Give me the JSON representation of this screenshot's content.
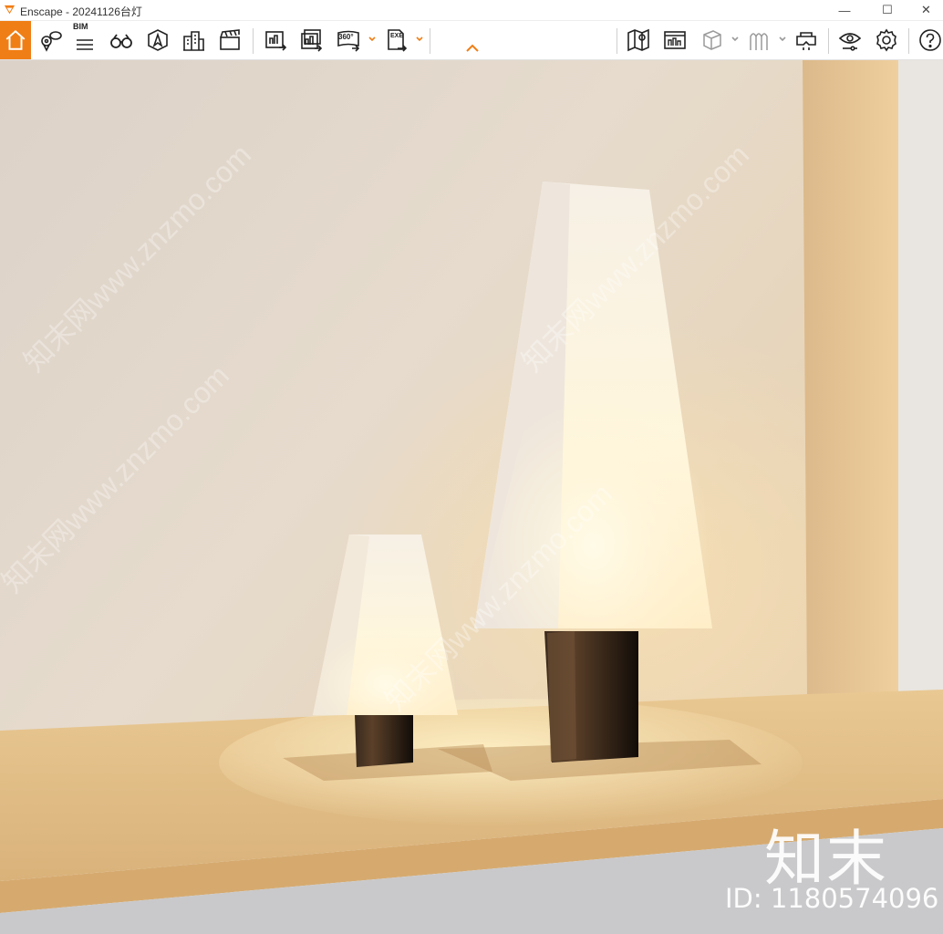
{
  "window": {
    "title": "Enscape - 20241126台灯",
    "minimize": "—",
    "maximize": "☐",
    "close": "✕"
  },
  "toolbar": {
    "bim_label": "BIM",
    "pano_label": "360°",
    "exe_label": "EXE",
    "accent_color": "#f07e16",
    "icons": [
      "home-icon",
      "location-pin-icon",
      "bim-list-icon",
      "binoculars-icon",
      "compass-icon",
      "buildings-icon",
      "clapboard-icon",
      "render-screenshot-icon",
      "batch-render-icon",
      "panorama-360-icon",
      "export-exe-icon",
      "map-icon",
      "assets-library-icon",
      "cube-icon",
      "fog-icon",
      "vr-headset-icon",
      "visual-settings-icon",
      "settings-gear-icon",
      "help-icon"
    ]
  },
  "viewport": {
    "watermark_text": "知末网www.znzmo.com",
    "brand": "知末",
    "id_text": "ID: 1180574096"
  }
}
